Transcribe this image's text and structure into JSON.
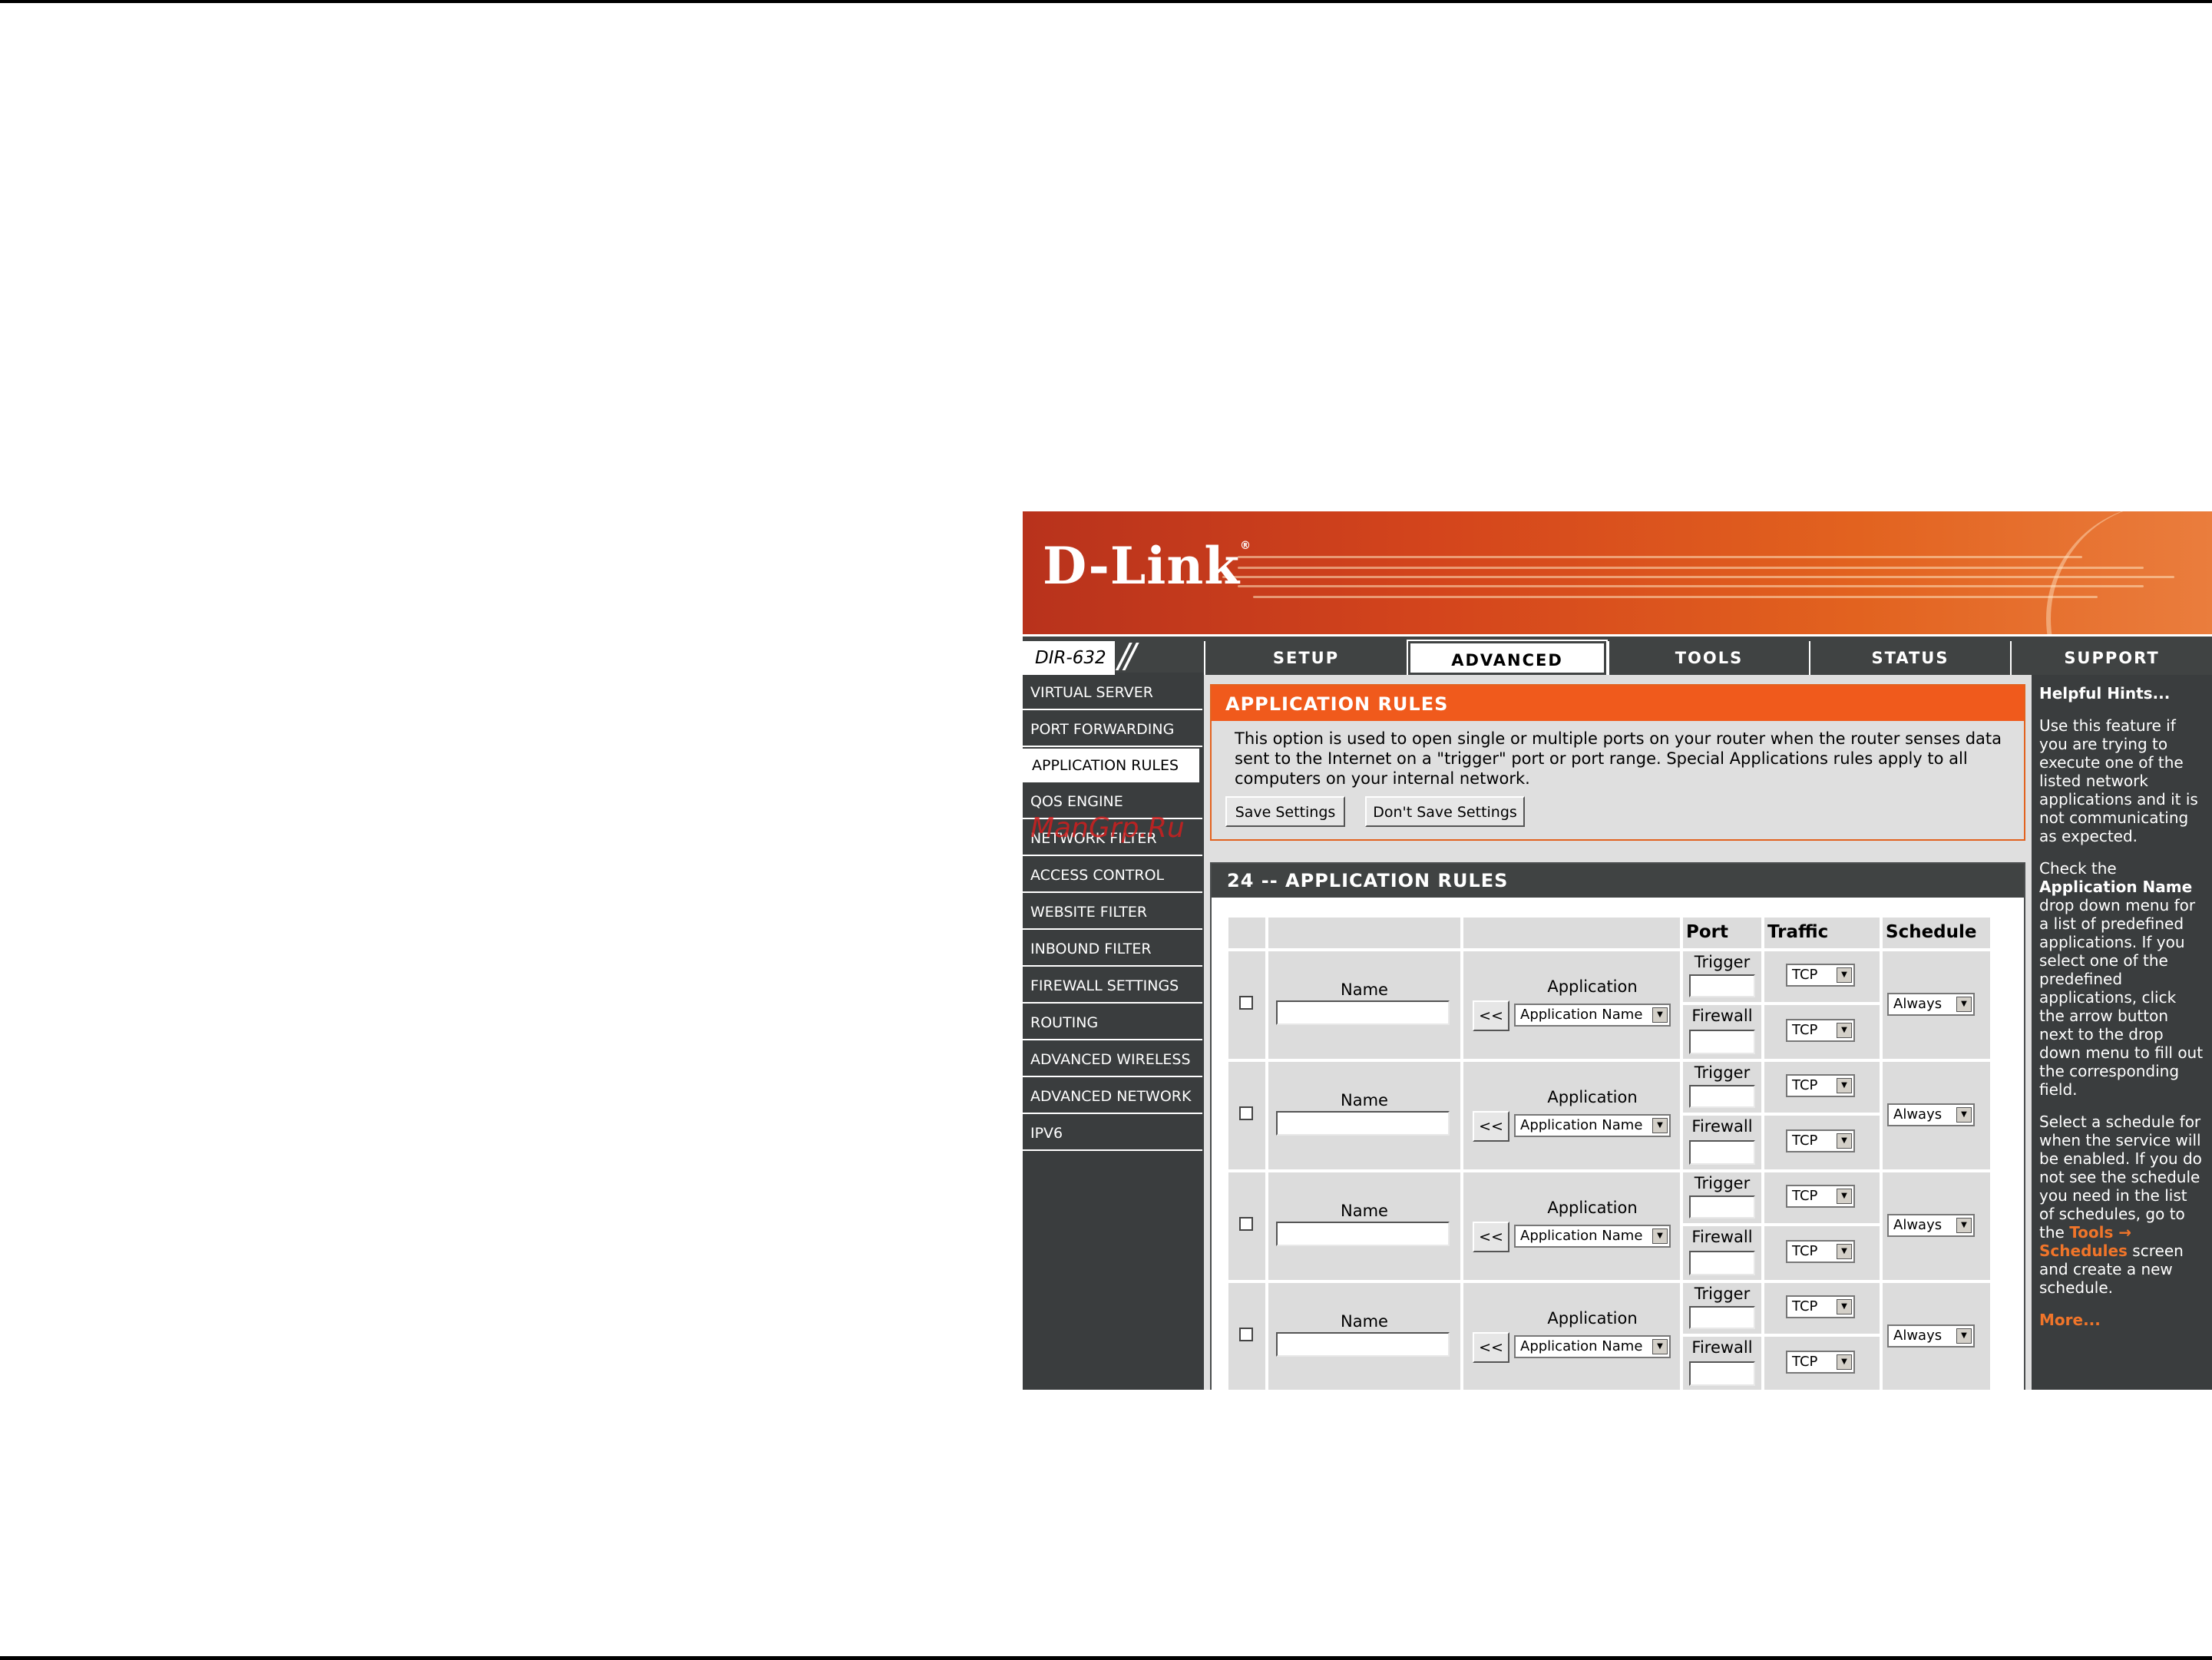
{
  "brand": {
    "logo": "D-Link",
    "model": "DIR-632"
  },
  "tabs": [
    "SETUP",
    "ADVANCED",
    "TOOLS",
    "STATUS",
    "SUPPORT"
  ],
  "active_tab": "ADVANCED",
  "menu": [
    "VIRTUAL SERVER",
    "PORT FORWARDING",
    "APPLICATION RULES",
    "QOS ENGINE",
    "NETWORK FILTER",
    "ACCESS CONTROL",
    "WEBSITE FILTER",
    "INBOUND FILTER",
    "FIREWALL SETTINGS",
    "ROUTING",
    "ADVANCED WIRELESS",
    "ADVANCED NETWORK",
    "IPV6"
  ],
  "active_menu": "APPLICATION RULES",
  "watermark": "ManGrp.Ru",
  "info": {
    "title": "APPLICATION RULES",
    "text": "This option is used to open single or multiple ports on your router when the router senses data sent to the Internet on a \"trigger\" port or port range. Special Applications rules apply to all computers on your internal network.",
    "save_label": "Save Settings",
    "dont_save_label": "Don't Save Settings"
  },
  "rules": {
    "title": "24 -- APPLICATION RULES",
    "headers": {
      "port": "Port",
      "traffic": "Traffic Type",
      "schedule": "Schedule"
    },
    "row_labels": {
      "name": "Name",
      "application": "Application",
      "trigger": "Trigger",
      "firewall": "Firewall",
      "back_button": "<<"
    },
    "rows": [
      {
        "name": "",
        "application": "Application Name",
        "trigger_type": "TCP",
        "firewall_type": "TCP",
        "schedule": "Always"
      },
      {
        "name": "",
        "application": "Application Name",
        "trigger_type": "TCP",
        "firewall_type": "TCP",
        "schedule": "Always"
      },
      {
        "name": "",
        "application": "Application Name",
        "trigger_type": "TCP",
        "firewall_type": "TCP",
        "schedule": "Always"
      },
      {
        "name": "",
        "application": "Application Name",
        "trigger_type": "TCP",
        "firewall_type": "TCP",
        "schedule": "Always"
      }
    ]
  },
  "hints": {
    "title": "Helpful Hints...",
    "p1": "Use this feature if you are trying to execute one of the listed network applications and it is not communicating as expected.",
    "p2_before": "Check the ",
    "p2_bold": "Application Name",
    "p2_after": " drop down menu for a list of predefined applications. If you select one of the predefined applications, click the arrow button next to the drop down menu to fill out the corresponding field.",
    "p3_before": "Select a schedule for when the service will be enabled. If you do not see the schedule you need in the list of schedules, go to the ",
    "p3_link": "Tools → Schedules",
    "p3_after": " screen and create a new schedule.",
    "more": "More..."
  },
  "colors": {
    "orange": "#f05a1c",
    "dark": "#3a3d3e",
    "hint_link": "#f0752a"
  }
}
